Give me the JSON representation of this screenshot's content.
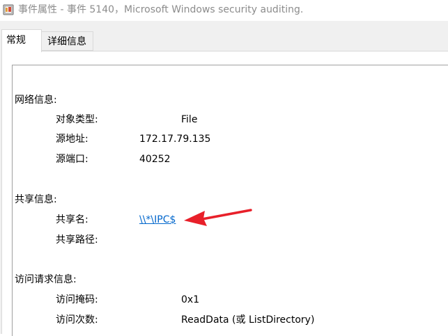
{
  "window": {
    "title": "事件属性 - 事件 5140，Microsoft Windows security auditing."
  },
  "tabs": [
    {
      "label": "常规",
      "selected": true
    },
    {
      "label": "详细信息",
      "selected": false
    }
  ],
  "sections": {
    "network": {
      "heading": "网络信息:",
      "fields": [
        {
          "label": "对象类型:",
          "value": "File"
        },
        {
          "label": "源地址:",
          "value": "172.17.79.135"
        },
        {
          "label": "源端口:",
          "value": "40252"
        }
      ]
    },
    "share": {
      "heading": "共享信息:",
      "fields": [
        {
          "label": "共享名:",
          "value": "\\\\*\\IPC$"
        },
        {
          "label": "共享路径:",
          "value": ""
        }
      ]
    },
    "access": {
      "heading": "访问请求信息:",
      "fields": [
        {
          "label": "访问掩码:",
          "value": "0x1"
        },
        {
          "label": "访问次数:",
          "value": "ReadData (或 ListDirectory)"
        }
      ]
    }
  },
  "colors": {
    "link": "#0066cc",
    "annotation_arrow": "#e8202a",
    "tab_strip_bg": "#f0f0f0",
    "title_text": "#8c8c8c"
  },
  "icons": {
    "title_icon": "event-viewer-icon",
    "annotation": "red-arrow-icon"
  }
}
